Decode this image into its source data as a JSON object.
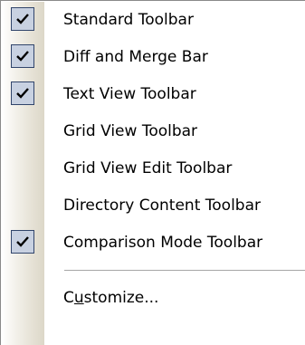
{
  "menu": {
    "items": [
      {
        "label": "Standard Toolbar",
        "checked": true
      },
      {
        "label": "Diff and Merge Bar",
        "checked": true
      },
      {
        "label": "Text View Toolbar",
        "checked": true
      },
      {
        "label": "Grid View Toolbar",
        "checked": false
      },
      {
        "label": "Grid View Edit Toolbar",
        "checked": false
      },
      {
        "label": "Directory Content Toolbar",
        "checked": false
      },
      {
        "label": "Comparison Mode Toolbar",
        "checked": true
      }
    ],
    "customize": {
      "label_before": "C",
      "label_accel": "u",
      "label_after": "stomize..."
    }
  },
  "colors": {
    "check_bg": "#c8d1e1",
    "check_border": "#31456b"
  },
  "icons": {
    "check": "checkmark-icon"
  }
}
